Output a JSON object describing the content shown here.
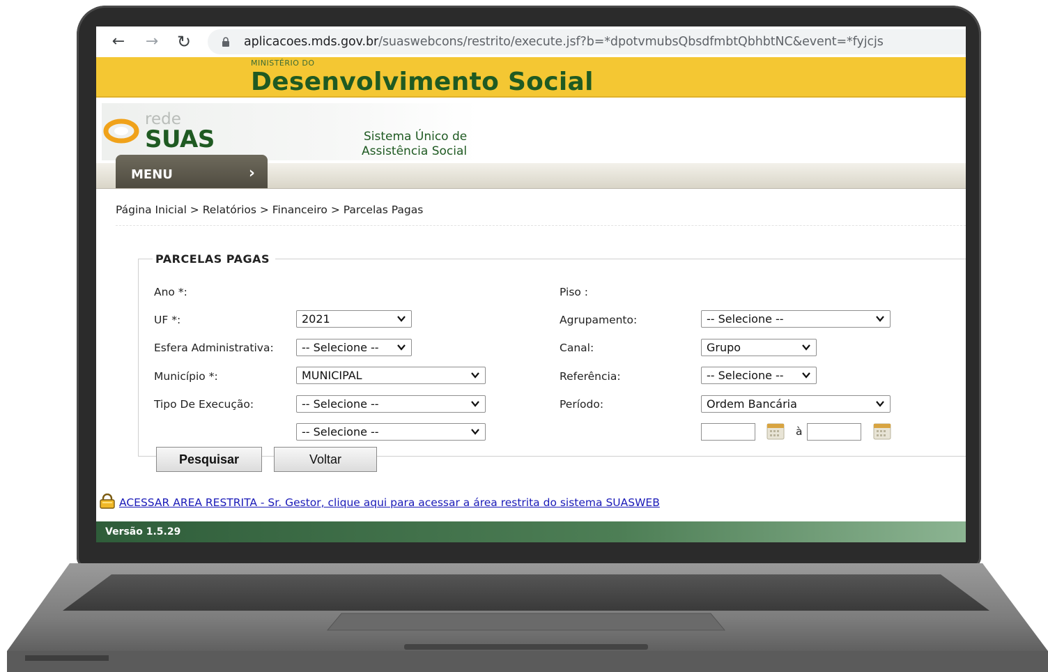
{
  "browser": {
    "url_host": "aplicacoes.mds.gov.br",
    "url_path": "/suaswebcons/restrito/execute.jsf?b=*dpotvmubsQbsdfmbtQbhbtNC&event=*fyjcjs"
  },
  "header": {
    "ministry_small": "MINISTÉRIO DO",
    "ministry_title": "Desenvolvimento Social",
    "logo_rede": "rede",
    "logo_suas": "SUAS",
    "system_line1": "Sistema Único de",
    "system_line2": "Assistência Social"
  },
  "menu": {
    "label": "MENU",
    "chevron": "›"
  },
  "breadcrumb": "Página Inicial > Relatórios > Financeiro > Parcelas Pagas",
  "form": {
    "legend": "PARCELAS PAGAS",
    "left": [
      {
        "label": "Ano *:",
        "value": "2021"
      },
      {
        "label": "UF *:",
        "value": "-- Selecione --"
      },
      {
        "label": "Esfera Administrativa:",
        "value": "MUNICIPAL"
      },
      {
        "label": "Município *:",
        "value": "-- Selecione --"
      },
      {
        "label": "Tipo De Execução:",
        "value": "-- Selecione --"
      }
    ],
    "right": [
      {
        "label": "Piso :",
        "value": "-- Selecione --"
      },
      {
        "label": "Agrupamento:",
        "value": "Grupo"
      },
      {
        "label": "Canal:",
        "value": "-- Selecione --"
      },
      {
        "label": "Referência:",
        "value": "Ordem Bancária"
      },
      {
        "label": "Período:"
      }
    ],
    "period_separator": "à",
    "search_button": "Pesquisar",
    "back_button": "Voltar"
  },
  "restricted_link": "ACESSAR AREA RESTRITA - Sr. Gestor, clique aqui para acessar a área restrita do sistema SUASWEB",
  "footer": {
    "version": "Versão 1.5.29"
  },
  "colors": {
    "banner_yellow": "#f4c733",
    "brand_green": "#1f5a22",
    "menu_brown": "#5e5a4d",
    "footer_green": "#2f5d3a",
    "link_blue": "#1a1ab8"
  }
}
